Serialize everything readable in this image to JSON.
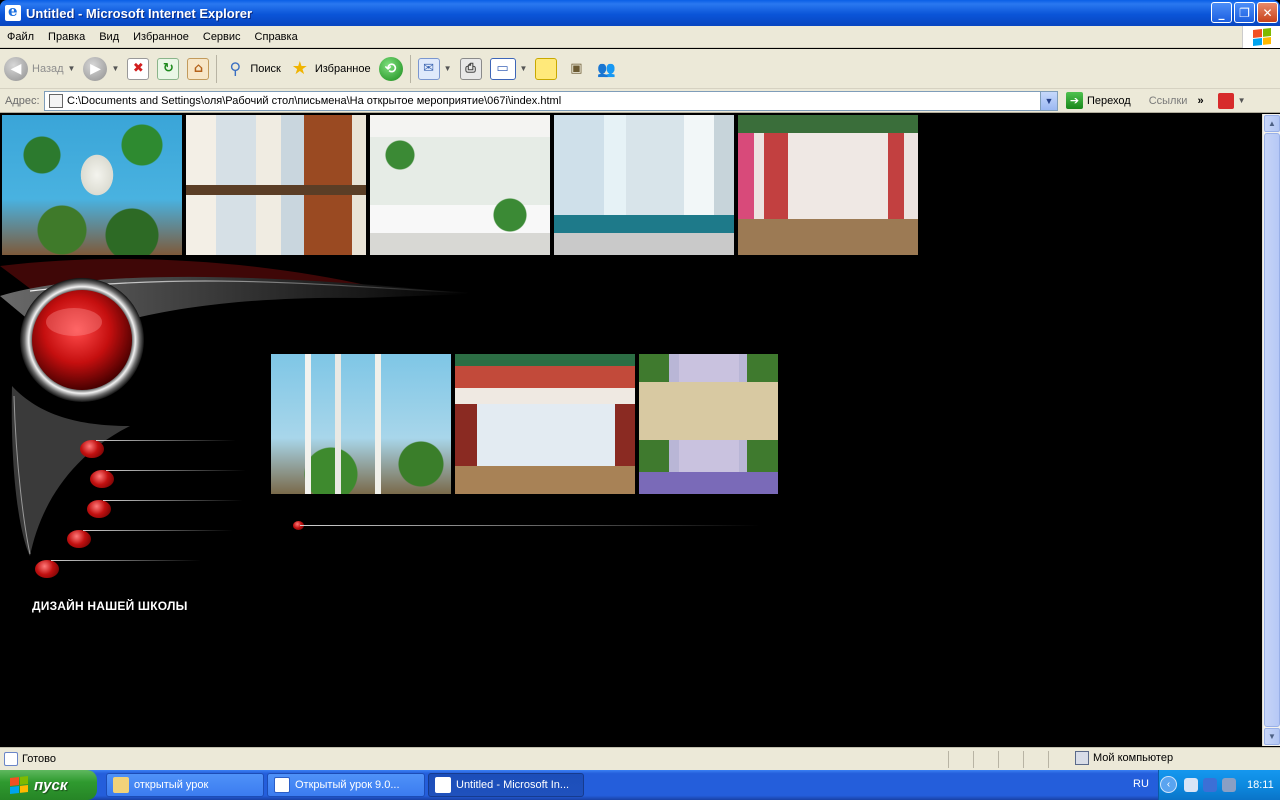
{
  "window": {
    "title": "Untitled - Microsoft Internet Explorer"
  },
  "menu": [
    "Файл",
    "Правка",
    "Вид",
    "Избранное",
    "Сервис",
    "Справка"
  ],
  "toolbar": {
    "back_label": "Назад",
    "search_label": "Поиск",
    "favorites_label": "Избранное"
  },
  "address": {
    "label": "Адрес:",
    "value": "C:\\Documents and Settings\\оля\\Рабочий стол\\письмена\\На открытое мероприятие\\067i\\index.html",
    "go_label": "Переход",
    "links_label": "Ссылки"
  },
  "page": {
    "heading": "ДИЗАЙН НАШЕЙ ШКОЛЫ"
  },
  "status": {
    "text": "Готово",
    "zone": "Мой компьютер"
  },
  "taskbar": {
    "start_label": "пуск",
    "tasks": [
      {
        "label": "открытый урок"
      },
      {
        "label": "Открытый урок 9.0..."
      },
      {
        "label": "Untitled - Microsoft In..."
      }
    ],
    "lang": "RU",
    "clock": "18:11"
  },
  "colors": {
    "accent_red": "#c11010",
    "xp_blue": "#245edb",
    "start_green": "#2f9a2f"
  }
}
